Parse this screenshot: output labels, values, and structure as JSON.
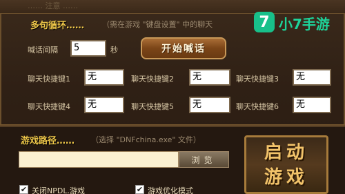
{
  "top": {
    "faded_text": "…… 注意 ……"
  },
  "loop_section": {
    "title": "多句循环……",
    "subtitle": "（需在游戏 \"键盘设置\" 中的聊天",
    "interval_label": "喊话间隔",
    "interval_value": "5",
    "interval_unit": "秒",
    "start_button": "开始喊话"
  },
  "shortcuts": [
    {
      "label": "聊天快捷键1",
      "value": "无"
    },
    {
      "label": "聊天快捷键2",
      "value": "无"
    },
    {
      "label": "聊天快捷键3",
      "value": "无"
    },
    {
      "label": "聊天快捷键4",
      "value": "无"
    },
    {
      "label": "聊天快捷键5",
      "value": "无"
    },
    {
      "label": "聊天快捷键6",
      "value": "无"
    }
  ],
  "path_section": {
    "title": "游戏路径……",
    "subtitle": "（选择 \"DNFchina.exe\" 文件）",
    "path_value": "",
    "browse_button": "浏览"
  },
  "launch_button": {
    "line1": "启动",
    "line2": "游戏"
  },
  "options": [
    {
      "label": "关闭NPDL.游戏",
      "checked": true
    },
    {
      "label": "游戏优化模式",
      "checked": true
    }
  ],
  "watermark": {
    "mark": "7",
    "text": "小7手游"
  },
  "colors": {
    "accent_gold": "#f0c84a",
    "watermark_green": "#1ed39a"
  }
}
